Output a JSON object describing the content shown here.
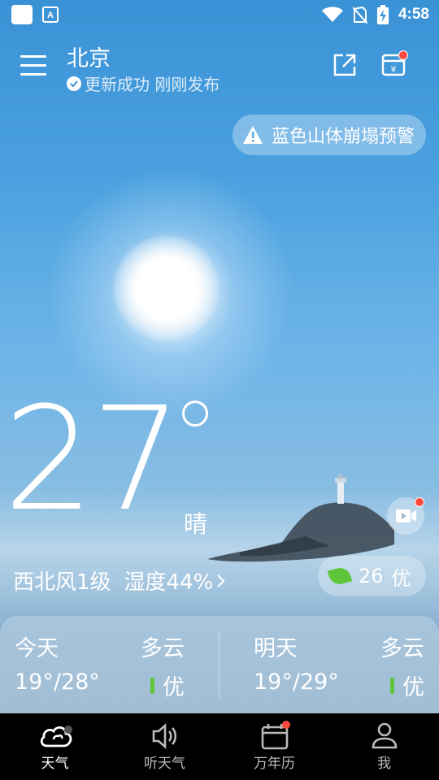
{
  "status_bar": {
    "time": "4:58",
    "icons": [
      "app-icon",
      "app-a-icon",
      "wifi-icon",
      "no-sim-icon",
      "battery-charging-icon"
    ]
  },
  "header": {
    "city": "北京",
    "update_status": "更新成功 刚刚发布",
    "icons": [
      "menu-icon",
      "share-icon",
      "calendar-bag-icon"
    ]
  },
  "alert": {
    "text": "蓝色山体崩塌预警",
    "icon": "warning-icon"
  },
  "current": {
    "temperature": "27",
    "condition": "晴",
    "wind": "西北风1级",
    "humidity": "湿度44%",
    "aqi_value": "26",
    "aqi_level": "优"
  },
  "forecast": [
    {
      "day": "今天",
      "condition": "多云",
      "temp_range": "19°/28°",
      "air_quality": "优"
    },
    {
      "day": "明天",
      "condition": "多云",
      "temp_range": "19°/29°",
      "air_quality": "优"
    }
  ],
  "nav": [
    {
      "label": "天气",
      "icon": "cloud-icon",
      "active": true
    },
    {
      "label": "听天气",
      "icon": "speaker-icon",
      "active": false
    },
    {
      "label": "万年历",
      "icon": "calendar-icon",
      "active": false
    },
    {
      "label": "我",
      "icon": "user-icon",
      "active": false
    }
  ],
  "colors": {
    "aqi_good": "#5ec53b",
    "badge": "#ff4a3d"
  }
}
